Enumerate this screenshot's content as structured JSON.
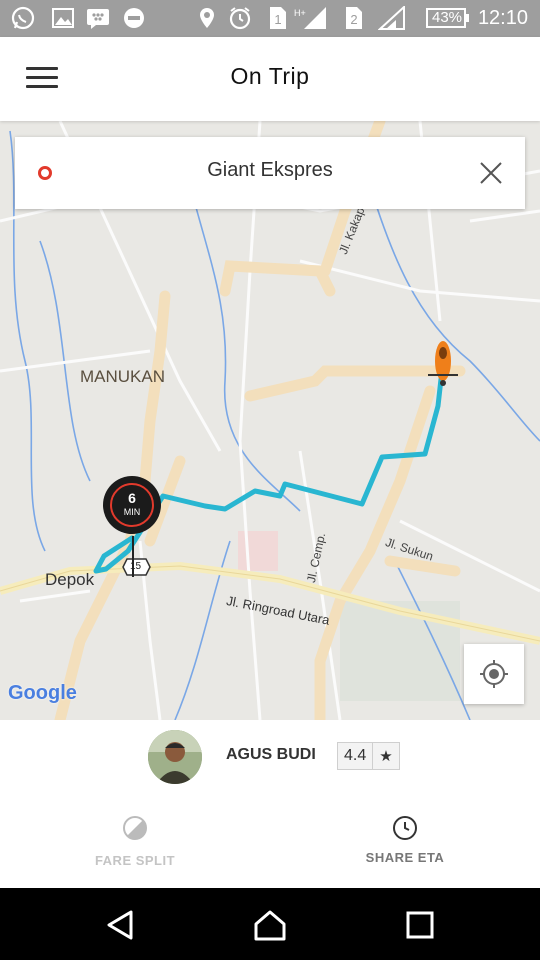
{
  "status_bar": {
    "battery": "43%",
    "time": "12:10",
    "sim1": "1",
    "sim2": "2"
  },
  "app_bar": {
    "title": "On Trip",
    "menu_icon": "hamburger-menu-icon"
  },
  "destination": {
    "text": "Giant Ekspres",
    "close_icon": "close-icon",
    "accent": "#e23a2c"
  },
  "map": {
    "labels": {
      "area_manukan": "MANUKAN",
      "area_depok": "Depok",
      "road_ringroad": "Jl. Ringroad Utara",
      "road_kakap": "Jl. Kakap R",
      "road_cemp": "Jl. Cemp.",
      "road_sukun": "Jl. Sukun",
      "road_route": "15"
    },
    "eta": {
      "value": "6",
      "unit": "MIN"
    },
    "route_color": "#29b6d1",
    "google_logo": "Google"
  },
  "driver": {
    "name": "AGUS BUDI",
    "rating": "4.4",
    "star": "★"
  },
  "actions": {
    "fare_split": "FARE SPLIT",
    "share_eta": "SHARE ETA"
  }
}
